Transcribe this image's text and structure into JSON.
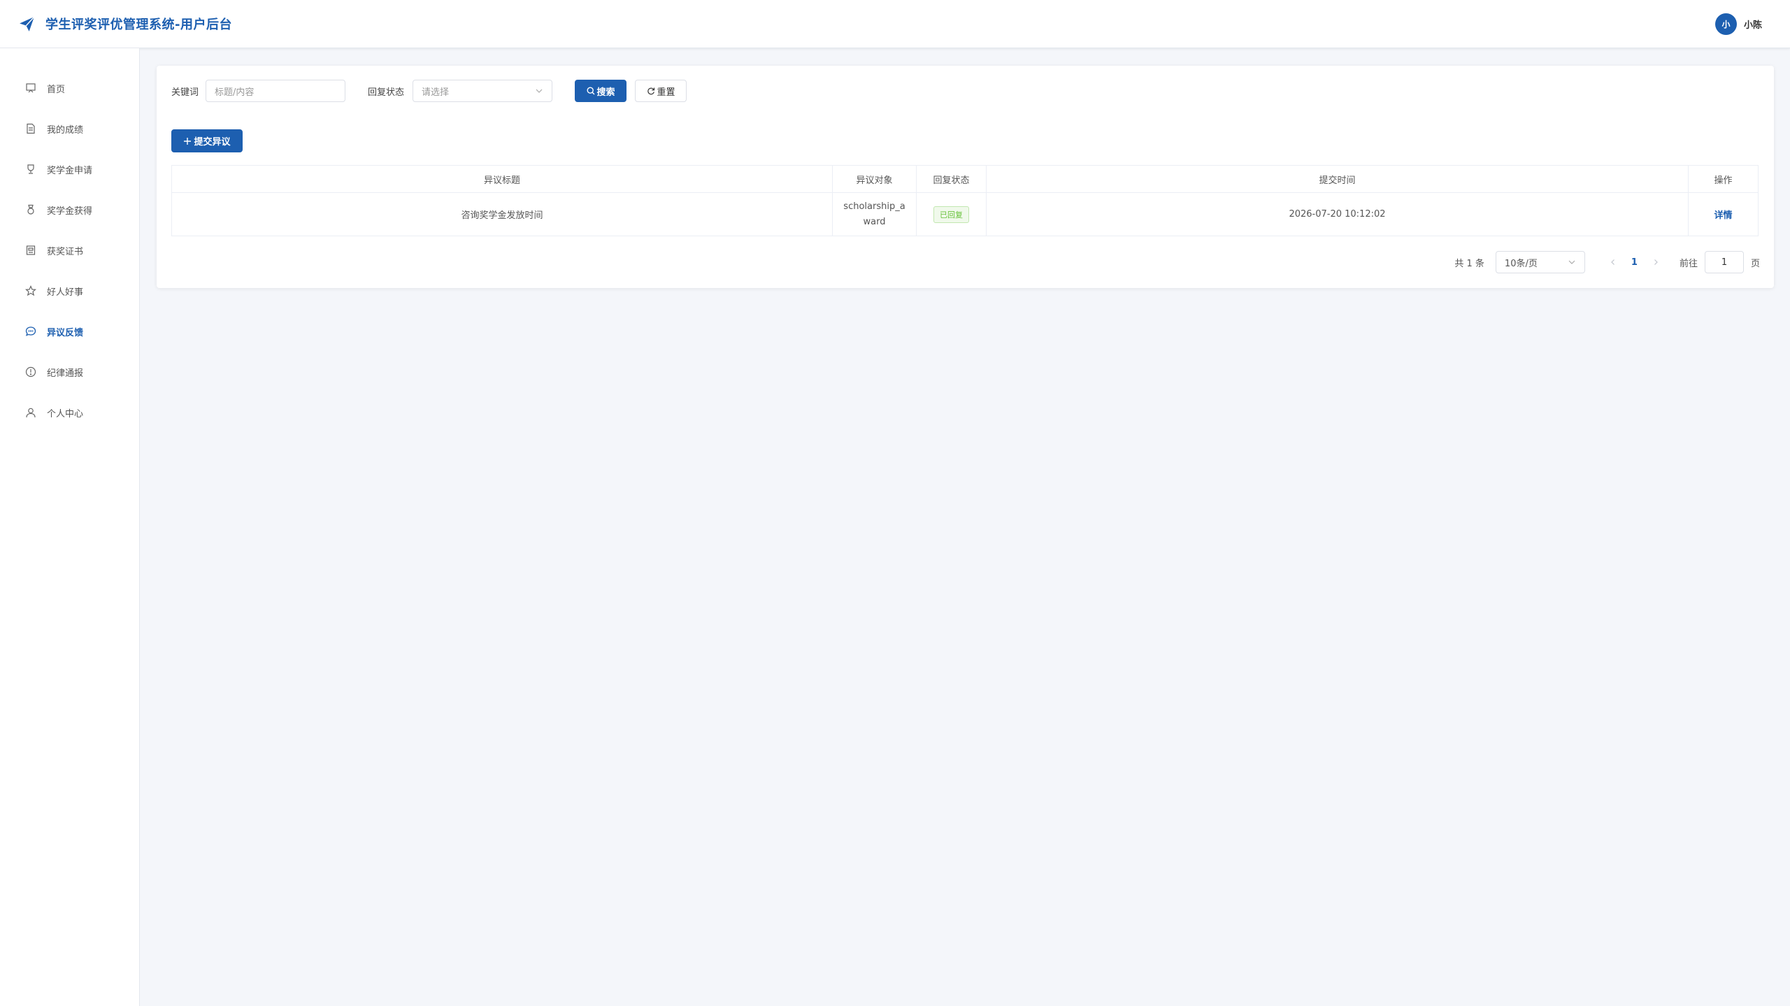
{
  "header": {
    "title": "学生评奖评优管理系统-用户后台",
    "user_avatar_text": "小",
    "username": "小陈"
  },
  "sidebar": {
    "items": [
      {
        "label": "首页",
        "icon": "home-icon"
      },
      {
        "label": "我的成绩",
        "icon": "document-icon"
      },
      {
        "label": "奖学金申请",
        "icon": "trophy-icon"
      },
      {
        "label": "奖学金获得",
        "icon": "medal-icon"
      },
      {
        "label": "获奖证书",
        "icon": "certificate-icon"
      },
      {
        "label": "好人好事",
        "icon": "star-icon"
      },
      {
        "label": "异议反馈",
        "icon": "chat-icon",
        "active": true
      },
      {
        "label": "纪律通报",
        "icon": "warning-icon"
      },
      {
        "label": "个人中心",
        "icon": "user-icon"
      }
    ]
  },
  "search": {
    "keyword_label": "关键词",
    "keyword_placeholder": "标题/内容",
    "status_label": "回复状态",
    "status_placeholder": "请选择",
    "search_button": "搜索",
    "reset_button": "重置"
  },
  "actions": {
    "add_button": "提交异议"
  },
  "table": {
    "columns": [
      "异议标题",
      "异议对象",
      "回复状态",
      "提交时间",
      "操作"
    ],
    "rows": [
      {
        "title": "咨询奖学金发放时间",
        "target": "scholarship_award",
        "status": "已回复",
        "submit_time": "2026-07-20 10:12:02",
        "action": "详情"
      }
    ]
  },
  "pagination": {
    "total_text": "共 1 条",
    "page_size": "10条/页",
    "current_page": "1",
    "goto_label": "前往",
    "goto_value": "1",
    "page_unit": "页"
  },
  "colors": {
    "primary": "#1d5fb0",
    "success": "#67c23a",
    "background": "#f4f6fa"
  }
}
